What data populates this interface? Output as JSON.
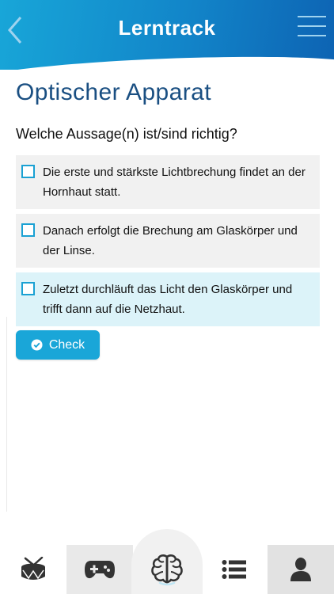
{
  "header": {
    "title": "Lerntrack",
    "back_icon": "chevron-left-icon",
    "menu_icon": "hamburger-menu-icon"
  },
  "page": {
    "title": "Optischer Apparat",
    "question": "Welche Aussage(n) ist/sind richtig?"
  },
  "options": [
    {
      "text": "Die erste und stärkste Lichtbrechung findet an der Hornhaut statt.",
      "checked": false
    },
    {
      "text": "Danach erfolgt die Brechung am Glaskörper und der Linse.",
      "checked": false
    },
    {
      "text": "Zuletzt durchläuft das Licht den Glaskörper und trifft dann auf die Netzhaut.",
      "checked": true
    }
  ],
  "check_button": {
    "label": "Check",
    "icon": "check-circle-icon"
  },
  "tabbar": {
    "tabs": [
      {
        "icon": "drum-icon"
      },
      {
        "icon": "gamepad-icon"
      },
      {
        "icon": "brain-icon",
        "active": true
      },
      {
        "icon": "list-icon"
      },
      {
        "icon": "user-icon"
      }
    ]
  },
  "colors": {
    "header_start": "#18a6d8",
    "header_end": "#0d63b3",
    "accent": "#1aa6d8",
    "title": "#1a4f82",
    "selected_bg": "#dcf3f9"
  }
}
